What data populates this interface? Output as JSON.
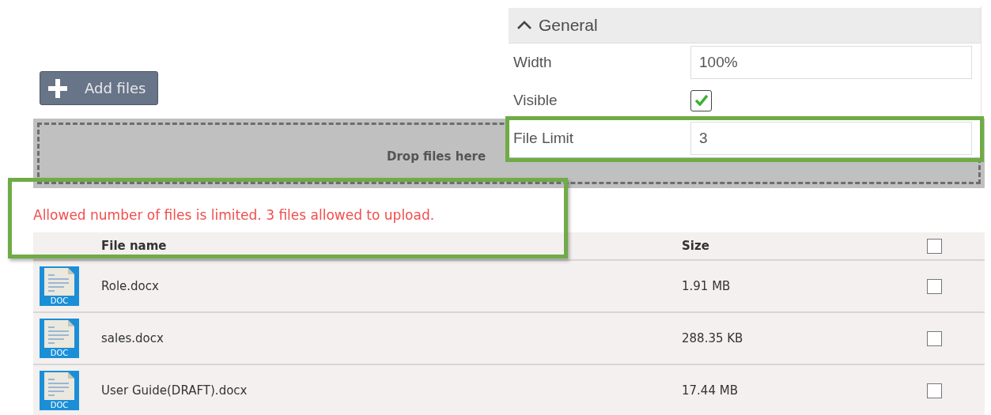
{
  "add_button": {
    "label": "Add files"
  },
  "drop_zone": {
    "text": "Drop files here"
  },
  "message": {
    "text": "Allowed number of files is limited. 3 files allowed to upload.",
    "highlighted": true
  },
  "table": {
    "columns": [
      "File name",
      "Size"
    ],
    "header_checkbox": {
      "checked": false
    },
    "rows": [
      {
        "type": "DOC",
        "name": "Role.docx",
        "size": "1.91 MB",
        "checked": false
      },
      {
        "type": "DOC",
        "name": "sales.docx",
        "size": "288.35 KB",
        "checked": false
      },
      {
        "type": "DOC",
        "name": "User Guide(DRAFT).docx",
        "size": "17.44 MB",
        "checked": false
      }
    ]
  },
  "properties": {
    "section": {
      "title": "General",
      "expanded": true
    },
    "fields": [
      {
        "kind": "text",
        "label": "Width",
        "value": "100%",
        "highlighted": false
      },
      {
        "kind": "checkbox",
        "label": "Visible",
        "checked": true,
        "highlighted": false
      },
      {
        "kind": "text",
        "label": "File Limit",
        "value": "3",
        "highlighted": true
      }
    ]
  }
}
